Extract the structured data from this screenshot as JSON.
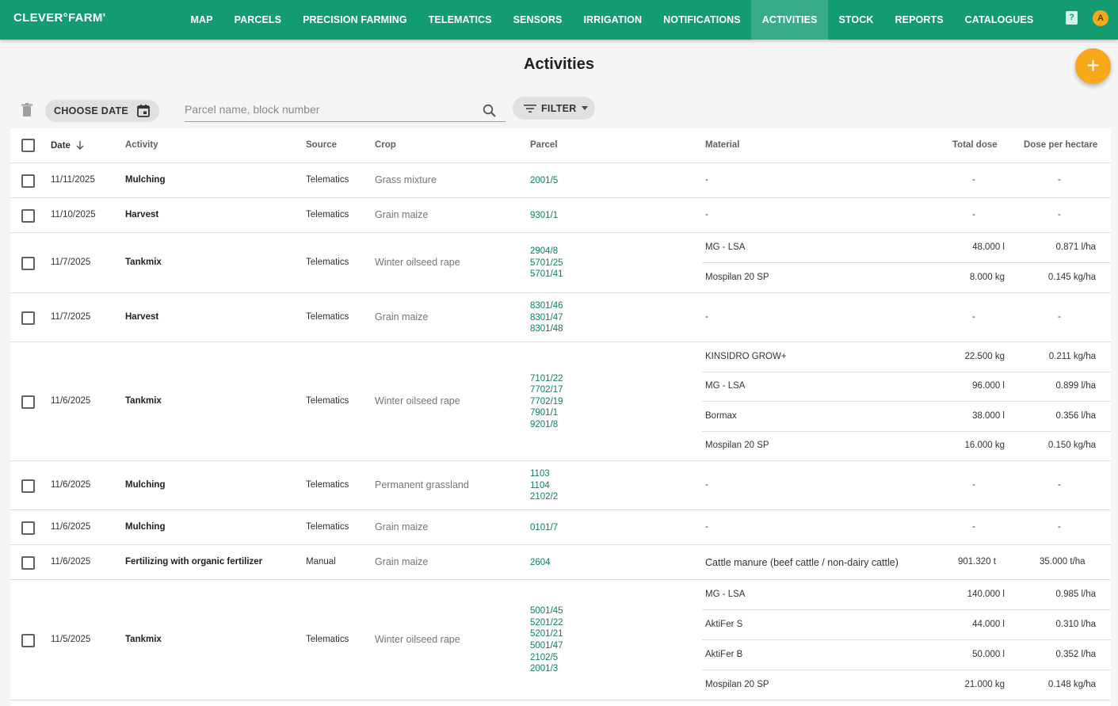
{
  "app": {
    "logo": "CLEVER°FARM'",
    "user_initial": "A",
    "help_glyph": "?"
  },
  "nav": [
    "MAP",
    "PARCELS",
    "PRECISION FARMING",
    "TELEMATICS",
    "SENSORS",
    "IRRIGATION",
    "NOTIFICATIONS",
    "ACTIVITIES",
    "STOCK",
    "REPORTS",
    "CATALOGUES"
  ],
  "active_nav": "ACTIVITIES",
  "page": {
    "title": "Activities",
    "add_glyph": "+"
  },
  "toolbar": {
    "choose_date": "CHOOSE DATE",
    "search_placeholder": "Parcel name, block number",
    "filter": "FILTER"
  },
  "columns": {
    "date": "Date",
    "activity": "Activity",
    "source": "Source",
    "crop": "Crop",
    "parcel": "Parcel",
    "material": "Material",
    "total_dose": "Total dose",
    "dose_per_hectare": "Dose per hectare"
  },
  "rows": [
    {
      "date": "11/11/2025",
      "activity": "Mulching",
      "source": "Telematics",
      "crop": "Grass mixture",
      "parcels": [
        "2001/5"
      ],
      "materials": [
        {
          "name": "-",
          "total": "-",
          "per_ha": "-"
        }
      ]
    },
    {
      "date": "11/10/2025",
      "activity": "Harvest",
      "source": "Telematics",
      "crop": "Grain maize",
      "parcels": [
        "9301/1"
      ],
      "materials": [
        {
          "name": "-",
          "total": "-",
          "per_ha": "-"
        }
      ]
    },
    {
      "date": "11/7/2025",
      "activity": "Tankmix",
      "source": "Telematics",
      "crop": "Winter oilseed rape",
      "parcels": [
        "2904/8",
        "5701/25",
        "5701/41"
      ],
      "materials": [
        {
          "name": "MG - LSA",
          "total": "48.000 l",
          "per_ha": "0.871 l/ha"
        },
        {
          "name": "Mospilan 20 SP",
          "total": "8.000 kg",
          "per_ha": "0.145 kg/ha"
        }
      ]
    },
    {
      "date": "11/7/2025",
      "activity": "Harvest",
      "source": "Telematics",
      "crop": "Grain maize",
      "parcels": [
        "8301/46",
        "8301/47",
        "8301/48"
      ],
      "materials": [
        {
          "name": "-",
          "total": "-",
          "per_ha": "-"
        }
      ]
    },
    {
      "date": "11/6/2025",
      "activity": "Tankmix",
      "source": "Telematics",
      "crop": "Winter oilseed rape",
      "parcels": [
        "7101/22",
        "7702/17",
        "7702/19",
        "7901/1",
        "9201/8"
      ],
      "materials": [
        {
          "name": "KINSIDRO GROW+",
          "total": "22.500 kg",
          "per_ha": "0.211 kg/ha"
        },
        {
          "name": "MG - LSA",
          "total": "96.000 l",
          "per_ha": "0.899 l/ha"
        },
        {
          "name": "Bormax",
          "total": "38.000 l",
          "per_ha": "0.356 l/ha"
        },
        {
          "name": "Mospilan 20 SP",
          "total": "16.000 kg",
          "per_ha": "0.150 kg/ha"
        }
      ]
    },
    {
      "date": "11/6/2025",
      "activity": "Mulching",
      "source": "Telematics",
      "crop": "Permanent grassland",
      "parcels": [
        "1103",
        "1104",
        "2102/2"
      ],
      "materials": [
        {
          "name": "-",
          "total": "-",
          "per_ha": "-"
        }
      ]
    },
    {
      "date": "11/6/2025",
      "activity": "Mulching",
      "source": "Telematics",
      "crop": "Grain maize",
      "parcels": [
        "0101/7"
      ],
      "materials": [
        {
          "name": "-",
          "total": "-",
          "per_ha": "-"
        }
      ]
    },
    {
      "date": "11/6/2025",
      "activity": "Fertilizing with organic fertilizer",
      "source": "Manual",
      "crop": "Grain maize",
      "parcels": [
        "2604"
      ],
      "materials": [
        {
          "name": "Cattle manure (beef cattle / non-dairy cattle)",
          "total": "901.320 t",
          "per_ha": "35.000 t/ha"
        }
      ]
    },
    {
      "date": "11/5/2025",
      "activity": "Tankmix",
      "source": "Telematics",
      "crop": "Winter oilseed rape",
      "parcels": [
        "5001/45",
        "5201/22",
        "5201/21",
        "5001/47",
        "2102/5",
        "2001/3"
      ],
      "materials": [
        {
          "name": "MG - LSA",
          "total": "140.000 l",
          "per_ha": "0.985 l/ha"
        },
        {
          "name": "AktiFer S",
          "total": "44.000 l",
          "per_ha": "0.310 l/ha"
        },
        {
          "name": "AktiFer B",
          "total": "50.000 l",
          "per_ha": "0.352 l/ha"
        },
        {
          "name": "Mospilan 20 SP",
          "total": "21.000 kg",
          "per_ha": "0.148 kg/ha"
        }
      ]
    }
  ]
}
